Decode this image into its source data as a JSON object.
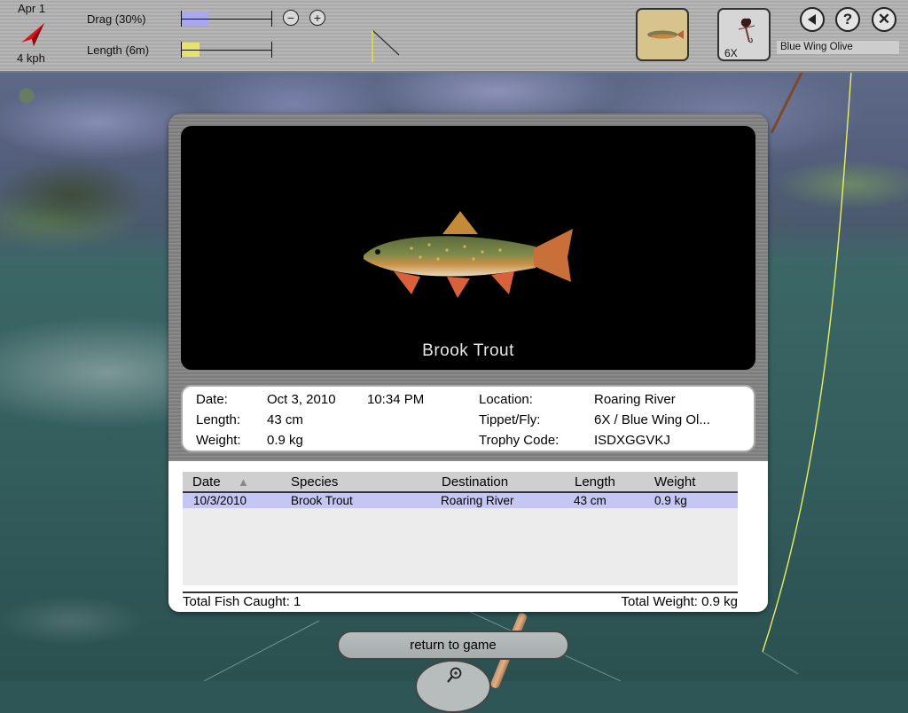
{
  "hud": {
    "date": "Apr 1",
    "speed": "4 kph",
    "drag_label": "Drag (30%)",
    "drag_fraction": 0.3,
    "length_label": "Length (6m)",
    "length_fraction": 0.2,
    "tippet": "6X",
    "fly_name": "Blue Wing Olive",
    "colors": {
      "drag_fill": "#a8a8f0",
      "length_fill": "#e8e070",
      "fish_tile": "#d6c48c"
    }
  },
  "modal": {
    "fish_name": "Brook Trout",
    "details": {
      "date_label": "Date:",
      "date_value": "Oct 3, 2010",
      "time_value": "10:34 PM",
      "length_label": "Length:",
      "length_value": "43 cm",
      "weight_label": "Weight:",
      "weight_value": "0.9 kg",
      "location_label": "Location:",
      "location_value": "Roaring River",
      "tippet_label": "Tippet/Fly:",
      "tippet_value": "6X / Blue Wing Ol...",
      "trophy_label": "Trophy Code:",
      "trophy_value": "ISDXGGVKJ"
    },
    "table": {
      "headers": [
        "Date",
        "Species",
        "Destination",
        "Length",
        "Weight"
      ],
      "sort_indicator": "▲",
      "rows": [
        [
          "10/3/2010",
          "Brook Trout",
          "Roaring River",
          "43 cm",
          "0.9 kg"
        ]
      ]
    },
    "totals": {
      "fish": "Total Fish Caught: 1",
      "weight": "Total Weight: 0.9 kg"
    }
  },
  "return_label": "return to game"
}
